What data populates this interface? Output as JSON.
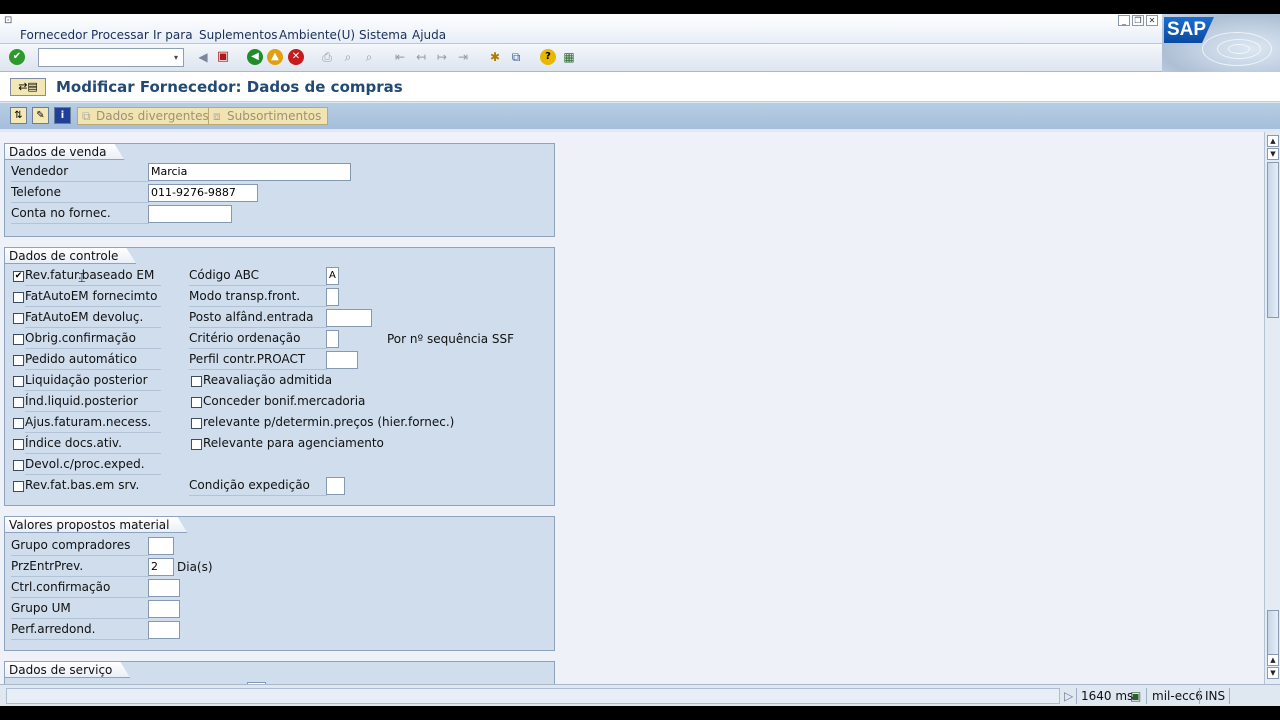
{
  "menubar": {
    "items": [
      "Fornecedor",
      "Processar",
      "Ir para",
      "Suplementos",
      "Ambiente(U)",
      "Sistema",
      "Ajuda"
    ]
  },
  "logo": {
    "text": "SAP"
  },
  "toolbar": {
    "icons": [
      "checkmark-icon",
      "back-icon",
      "save-icon",
      "green-back-icon",
      "exit-icon",
      "cancel-icon",
      "print-icon",
      "find-icon",
      "find-next-icon",
      "first-page-icon",
      "prev-page-icon",
      "next-page-icon",
      "last-page-icon",
      "new-session-icon",
      "shortcut-icon",
      "help-icon",
      "layout-icon"
    ]
  },
  "title": {
    "text": "Modificar Fornecedor: Dados de compras"
  },
  "apptoolbar": {
    "btn1": "Dados divergentes",
    "btn2": "Subsortimentos"
  },
  "vendas": {
    "title": "Dados de venda",
    "vendedor_label": "Vendedor",
    "vendedor_value": "Marcia",
    "telefone_label": "Telefone",
    "telefone_value": "011-9276-9887",
    "conta_label": "Conta no fornec.",
    "conta_value": ""
  },
  "controle": {
    "title": "Dados de controle",
    "left": [
      {
        "label": "Rev.fatur.baseado EM",
        "checked": true
      },
      {
        "label": "FatAutoEM fornecimto",
        "checked": false
      },
      {
        "label": "FatAutoEM devoluç.",
        "checked": false
      },
      {
        "label": "Obrig.confirmação",
        "checked": false
      },
      {
        "label": "Pedido automático",
        "checked": false
      },
      {
        "label": "Liquidação posterior",
        "checked": false
      },
      {
        "label": "Índ.liquid.posterior",
        "checked": false
      },
      {
        "label": "Ajus.faturam.necess.",
        "checked": false
      },
      {
        "label": "Índice docs.ativ.",
        "checked": false
      },
      {
        "label": "Devol.c/proc.exped.",
        "checked": false
      },
      {
        "label": "Rev.fat.bas.em srv.",
        "checked": false
      }
    ],
    "abc_label": "Código ABC",
    "abc_value": "A",
    "modo_label": "Modo transp.front.",
    "posto_label": "Posto alfând.entrada",
    "criterio_label": "Critério ordenação",
    "criterio_text": "Por nº sequência SSF",
    "perfil_label": "Perfil contr.PROACT",
    "right_checks": [
      {
        "label": "Reavaliação admitida",
        "checked": false
      },
      {
        "label": "Conceder bonif.mercadoria",
        "checked": false
      },
      {
        "label": "relevante p/determin.preços (hier.fornec.)",
        "checked": false
      },
      {
        "label": "Relevante para agenciamento",
        "checked": false
      }
    ],
    "condicao_label": "Condição expedição"
  },
  "material": {
    "title": "Valores propostos material",
    "grupo_label": "Grupo compradores",
    "prz_label": "PrzEntrPrev.",
    "prz_value": "2",
    "prz_unit": "Dia(s)",
    "ctrl_label": "Ctrl.confirmação",
    "grupoum_label": "Grupo UM",
    "perf_label": "Perf.arredond."
  },
  "servico": {
    "title": "Dados de serviço"
  },
  "status": {
    "time": "1640 ms",
    "server": "mil-ecc6",
    "mode": "INS"
  }
}
